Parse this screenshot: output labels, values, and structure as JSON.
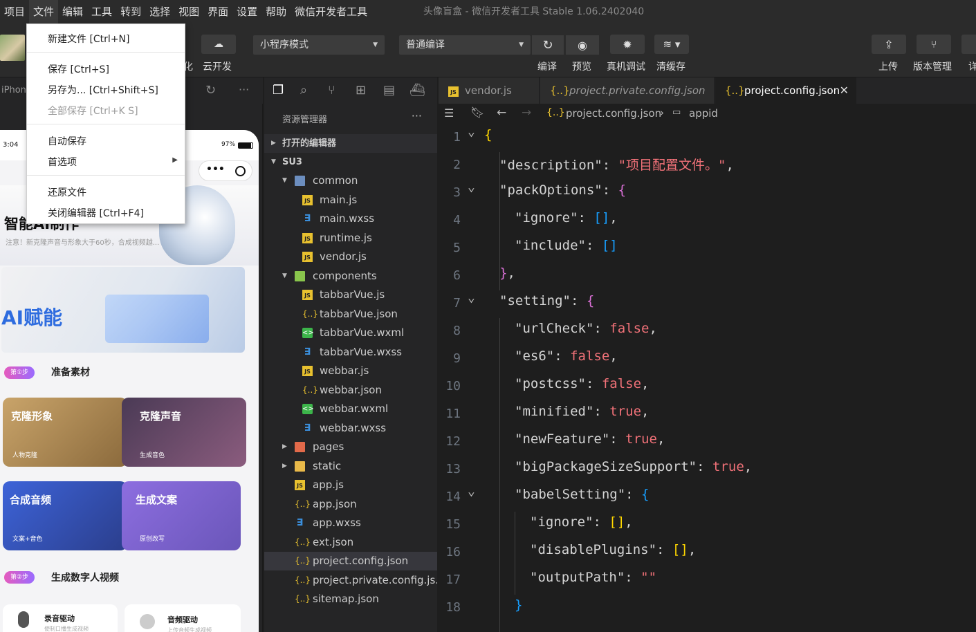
{
  "menubar": {
    "items": [
      "项目",
      "文件",
      "编辑",
      "工具",
      "转到",
      "选择",
      "视图",
      "界面",
      "设置",
      "帮助",
      "微信开发者工具"
    ],
    "window_title": "头像盲盒 - 微信开发者工具 Stable 1.06.2402040"
  },
  "toolbar": {
    "partial_left_label": "化",
    "cloud_label": "云开发",
    "mode_select": "小程序模式",
    "compile_select": "普通编译",
    "compile_label": "编译",
    "preview_label": "预览",
    "debug_label": "真机调试",
    "clear_cache_label": "清缓存",
    "upload_label": "上传",
    "version_label": "版本管理",
    "details_label": "详"
  },
  "file_menu": {
    "items": [
      {
        "label": "新建文件  [Ctrl+N]",
        "disabled": false
      },
      {
        "label": "保存  [Ctrl+S]",
        "disabled": false
      },
      {
        "label": "另存为...  [Ctrl+Shift+S]",
        "disabled": false
      },
      {
        "label": "全部保存  [Ctrl+K S]",
        "disabled": true
      },
      {
        "label": "自动保存",
        "disabled": false
      },
      {
        "label": "首选项",
        "disabled": false,
        "submenu": true
      },
      {
        "label": "还原文件",
        "disabled": false
      },
      {
        "label": "关闭编辑器  [Ctrl+F4]",
        "disabled": false
      }
    ]
  },
  "simulator": {
    "device_label": "iPhone",
    "status_time": "3:04",
    "battery": "97%",
    "header_title": "智能AI制作",
    "notice": "注意！新克隆声音与形象大于60秒，合成视频越...",
    "banner_text": "AI赋能",
    "step1_badge": "第①步",
    "step1_title": "准备素材",
    "cards": [
      {
        "title": "克隆形象",
        "sub": "人物克隆"
      },
      {
        "title": "克隆声音",
        "sub": "生成音色"
      },
      {
        "title": "合成音频",
        "sub": "文案+音色"
      },
      {
        "title": "生成文案",
        "sub": "原创改写"
      }
    ],
    "step2_badge": "第②步",
    "step2_title": "生成数字人视频",
    "bottom_cards": [
      {
        "title": "录音驱动",
        "sub": "使制口播生成视频"
      },
      {
        "title": "音频驱动",
        "sub": "上传音频生成视频"
      }
    ]
  },
  "explorer": {
    "title": "资源管理器",
    "more": "···",
    "open_editors": "打开的编辑器",
    "project": "SU3",
    "tree": [
      {
        "name": "common",
        "type": "folder",
        "depth": 1,
        "open": true
      },
      {
        "name": "main.js",
        "type": "js",
        "depth": 2
      },
      {
        "name": "main.wxss",
        "type": "wxss",
        "depth": 2
      },
      {
        "name": "runtime.js",
        "type": "js",
        "depth": 2
      },
      {
        "name": "vendor.js",
        "type": "js",
        "depth": 2
      },
      {
        "name": "components",
        "type": "folder-g",
        "depth": 1,
        "open": true
      },
      {
        "name": "tabbarVue.js",
        "type": "js",
        "depth": 2
      },
      {
        "name": "tabbarVue.json",
        "type": "json",
        "depth": 2
      },
      {
        "name": "tabbarVue.wxml",
        "type": "wxml",
        "depth": 2
      },
      {
        "name": "tabbarVue.wxss",
        "type": "wxss",
        "depth": 2
      },
      {
        "name": "webbar.js",
        "type": "js",
        "depth": 2
      },
      {
        "name": "webbar.json",
        "type": "json",
        "depth": 2
      },
      {
        "name": "webbar.wxml",
        "type": "wxml",
        "depth": 2
      },
      {
        "name": "webbar.wxss",
        "type": "wxss",
        "depth": 2
      },
      {
        "name": "pages",
        "type": "folder-r",
        "depth": 1,
        "open": false
      },
      {
        "name": "static",
        "type": "folder-y",
        "depth": 1,
        "open": false
      },
      {
        "name": "app.js",
        "type": "js",
        "depth": 1
      },
      {
        "name": "app.json",
        "type": "json",
        "depth": 1
      },
      {
        "name": "app.wxss",
        "type": "wxss",
        "depth": 1
      },
      {
        "name": "ext.json",
        "type": "json",
        "depth": 1
      },
      {
        "name": "project.config.json",
        "type": "json",
        "depth": 1,
        "selected": true
      },
      {
        "name": "project.private.config.js...",
        "type": "json",
        "depth": 1
      },
      {
        "name": "sitemap.json",
        "type": "json",
        "depth": 1
      }
    ]
  },
  "tabs": [
    {
      "name": "vendor.js",
      "icon": "js",
      "active": false
    },
    {
      "name": "project.private.config.json",
      "icon": "json",
      "active": false
    },
    {
      "name": "project.config.json",
      "icon": "json",
      "active": true
    }
  ],
  "breadcrumb": {
    "file": "project.config.json",
    "symbol": "appid"
  },
  "editor": {
    "lines": [
      {
        "n": "1",
        "indent": 0,
        "tokens": [
          {
            "t": "{",
            "c": "brace1"
          }
        ],
        "fold": true
      },
      {
        "n": "2",
        "indent": 1,
        "tokens": [
          {
            "t": "\"description\"",
            "c": "key"
          },
          {
            "t": ": ",
            "c": "punc"
          },
          {
            "t": "\"项目配置文件。\"",
            "c": "str"
          },
          {
            "t": ",",
            "c": "punc"
          }
        ]
      },
      {
        "n": "3",
        "indent": 1,
        "tokens": [
          {
            "t": "\"packOptions\"",
            "c": "key"
          },
          {
            "t": ": ",
            "c": "punc"
          },
          {
            "t": "{",
            "c": "brace2"
          }
        ],
        "fold": true
      },
      {
        "n": "4",
        "indent": 2,
        "tokens": [
          {
            "t": "\"ignore\"",
            "c": "key"
          },
          {
            "t": ": ",
            "c": "punc"
          },
          {
            "t": "[]",
            "c": "brace3"
          },
          {
            "t": ",",
            "c": "punc"
          }
        ]
      },
      {
        "n": "5",
        "indent": 2,
        "tokens": [
          {
            "t": "\"include\"",
            "c": "key"
          },
          {
            "t": ": ",
            "c": "punc"
          },
          {
            "t": "[]",
            "c": "brace3"
          }
        ]
      },
      {
        "n": "6",
        "indent": 1,
        "tokens": [
          {
            "t": "}",
            "c": "brace2"
          },
          {
            "t": ",",
            "c": "punc"
          }
        ]
      },
      {
        "n": "7",
        "indent": 1,
        "tokens": [
          {
            "t": "\"setting\"",
            "c": "key"
          },
          {
            "t": ": ",
            "c": "punc"
          },
          {
            "t": "{",
            "c": "brace2"
          }
        ],
        "fold": true
      },
      {
        "n": "8",
        "indent": 2,
        "tokens": [
          {
            "t": "\"urlCheck\"",
            "c": "key"
          },
          {
            "t": ": ",
            "c": "punc"
          },
          {
            "t": "false",
            "c": "kw"
          },
          {
            "t": ",",
            "c": "punc"
          }
        ]
      },
      {
        "n": "9",
        "indent": 2,
        "tokens": [
          {
            "t": "\"es6\"",
            "c": "key"
          },
          {
            "t": ": ",
            "c": "punc"
          },
          {
            "t": "false",
            "c": "kw"
          },
          {
            "t": ",",
            "c": "punc"
          }
        ]
      },
      {
        "n": "10",
        "indent": 2,
        "tokens": [
          {
            "t": "\"postcss\"",
            "c": "key"
          },
          {
            "t": ": ",
            "c": "punc"
          },
          {
            "t": "false",
            "c": "kw"
          },
          {
            "t": ",",
            "c": "punc"
          }
        ]
      },
      {
        "n": "11",
        "indent": 2,
        "tokens": [
          {
            "t": "\"minified\"",
            "c": "key"
          },
          {
            "t": ": ",
            "c": "punc"
          },
          {
            "t": "true",
            "c": "kw"
          },
          {
            "t": ",",
            "c": "punc"
          }
        ]
      },
      {
        "n": "12",
        "indent": 2,
        "tokens": [
          {
            "t": "\"newFeature\"",
            "c": "key"
          },
          {
            "t": ": ",
            "c": "punc"
          },
          {
            "t": "true",
            "c": "kw"
          },
          {
            "t": ",",
            "c": "punc"
          }
        ]
      },
      {
        "n": "13",
        "indent": 2,
        "tokens": [
          {
            "t": "\"bigPackageSizeSupport\"",
            "c": "key"
          },
          {
            "t": ": ",
            "c": "punc"
          },
          {
            "t": "true",
            "c": "kw"
          },
          {
            "t": ",",
            "c": "punc"
          }
        ]
      },
      {
        "n": "14",
        "indent": 2,
        "tokens": [
          {
            "t": "\"babelSetting\"",
            "c": "key"
          },
          {
            "t": ": ",
            "c": "punc"
          },
          {
            "t": "{",
            "c": "brace3"
          }
        ],
        "fold": true
      },
      {
        "n": "15",
        "indent": 3,
        "tokens": [
          {
            "t": "\"ignore\"",
            "c": "key"
          },
          {
            "t": ": ",
            "c": "punc"
          },
          {
            "t": "[]",
            "c": "brace1"
          },
          {
            "t": ",",
            "c": "punc"
          }
        ]
      },
      {
        "n": "16",
        "indent": 3,
        "tokens": [
          {
            "t": "\"disablePlugins\"",
            "c": "key"
          },
          {
            "t": ": ",
            "c": "punc"
          },
          {
            "t": "[]",
            "c": "brace1"
          },
          {
            "t": ",",
            "c": "punc"
          }
        ]
      },
      {
        "n": "17",
        "indent": 3,
        "tokens": [
          {
            "t": "\"outputPath\"",
            "c": "key"
          },
          {
            "t": ": ",
            "c": "punc"
          },
          {
            "t": "\"\"",
            "c": "str"
          }
        ]
      },
      {
        "n": "18",
        "indent": 2,
        "tokens": [
          {
            "t": "}",
            "c": "brace3"
          }
        ]
      }
    ]
  },
  "colors": {
    "menubar_bg": "#2b2b2b",
    "editor_bg": "#1e1e1e",
    "string": "#f07178",
    "bracket_gold": "#ffd700",
    "bracket_purple": "#da70d6",
    "bracket_blue": "#179fff",
    "js_icon": "#e8c12f",
    "wxss_icon": "#3b8fdc",
    "wxml_icon": "#3cb54a"
  }
}
